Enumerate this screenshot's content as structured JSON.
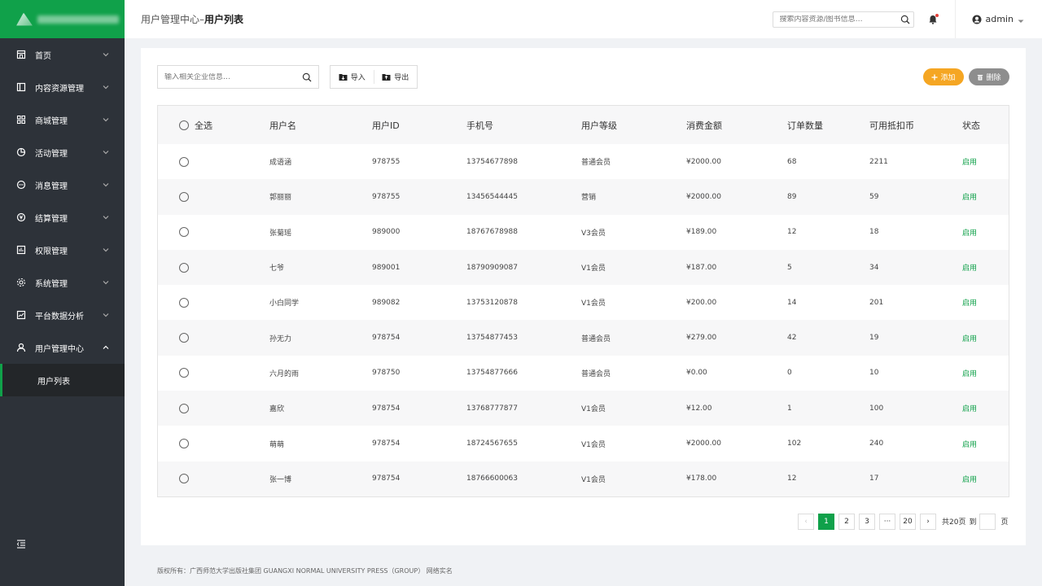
{
  "sidebar": {
    "items": [
      {
        "label": "首页",
        "icon": "home-icon"
      },
      {
        "label": "内容资源管理",
        "icon": "content-icon"
      },
      {
        "label": "商城管理",
        "icon": "grid-icon"
      },
      {
        "label": "活动管理",
        "icon": "pie-icon"
      },
      {
        "label": "消息管理",
        "icon": "message-icon"
      },
      {
        "label": "结算管理",
        "icon": "settlement-icon"
      },
      {
        "label": "权限管理",
        "icon": "permission-icon"
      },
      {
        "label": "系统管理",
        "icon": "gear-icon"
      },
      {
        "label": "平台数据分析",
        "icon": "chart-icon"
      },
      {
        "label": "用户管理中心",
        "icon": "user-icon"
      }
    ],
    "subitem": "用户列表"
  },
  "header": {
    "crumb_parent": "用户管理中心–",
    "crumb_current": "用户列表",
    "search_placeholder": "搜索内容资源/图书信息…",
    "username": "admin"
  },
  "toolbar": {
    "search_placeholder": "输入相关企业信息…",
    "import_label": "导入",
    "export_label": "导出",
    "add_label": "添加",
    "delete_label": "删除"
  },
  "table": {
    "select_all": "全选",
    "headers": [
      "用户名",
      "用户ID",
      "手机号",
      "用户等级",
      "消费金额",
      "订单数量",
      "可用抵扣币",
      "状态"
    ],
    "rows": [
      [
        "成语涵",
        "978755",
        "13754677898",
        "普通会员",
        "¥2000.00",
        "68",
        "2211",
        "启用"
      ],
      [
        "郭丽丽",
        "978755",
        "13456544445",
        "营销",
        "¥2000.00",
        "89",
        "59",
        "启用"
      ],
      [
        "张菊瑶",
        "989000",
        "18767678988",
        "V3会员",
        "¥189.00",
        "12",
        "18",
        "启用"
      ],
      [
        "七爷",
        "989001",
        "18790909087",
        "V1会员",
        "¥187.00",
        "5",
        "34",
        "启用"
      ],
      [
        "小白同学",
        "989082",
        "13753120878",
        "V1会员",
        "¥200.00",
        "14",
        "201",
        "启用"
      ],
      [
        "孙无力",
        "978754",
        "13754877453",
        "普通会员",
        "¥279.00",
        "42",
        "19",
        "启用"
      ],
      [
        "六月的雨",
        "978750",
        "13754877666",
        "普通会员",
        "¥0.00",
        "0",
        "10",
        "启用"
      ],
      [
        "嘉欣",
        "978754",
        "13768777877",
        "V1会员",
        "¥12.00",
        "1",
        "100",
        "启用"
      ],
      [
        "萌萌",
        "978754",
        "18724567655",
        "V1会员",
        "¥2000.00",
        "102",
        "240",
        "启用"
      ],
      [
        "张一博",
        "978754",
        "18766600063",
        "V1会员",
        "¥178.00",
        "12",
        "17",
        "启用"
      ]
    ]
  },
  "pagination": {
    "prev": "‹",
    "pages": [
      "1",
      "2",
      "3",
      "···",
      "20"
    ],
    "next": "›",
    "total": "共20页",
    "goto": "到",
    "unit": "页"
  },
  "footer": {
    "text": "版权所有：广西师范大学出版社集团 GUANGXI NORMAL UNIVERSITY PRESS（GROUP） 网络实名"
  },
  "colors": {
    "brand": "#10a14a",
    "sidebar_bg": "#2d3239",
    "add_button": "#f5a623",
    "delete_button": "#8e8e8e",
    "status_on": "#10a14a"
  }
}
